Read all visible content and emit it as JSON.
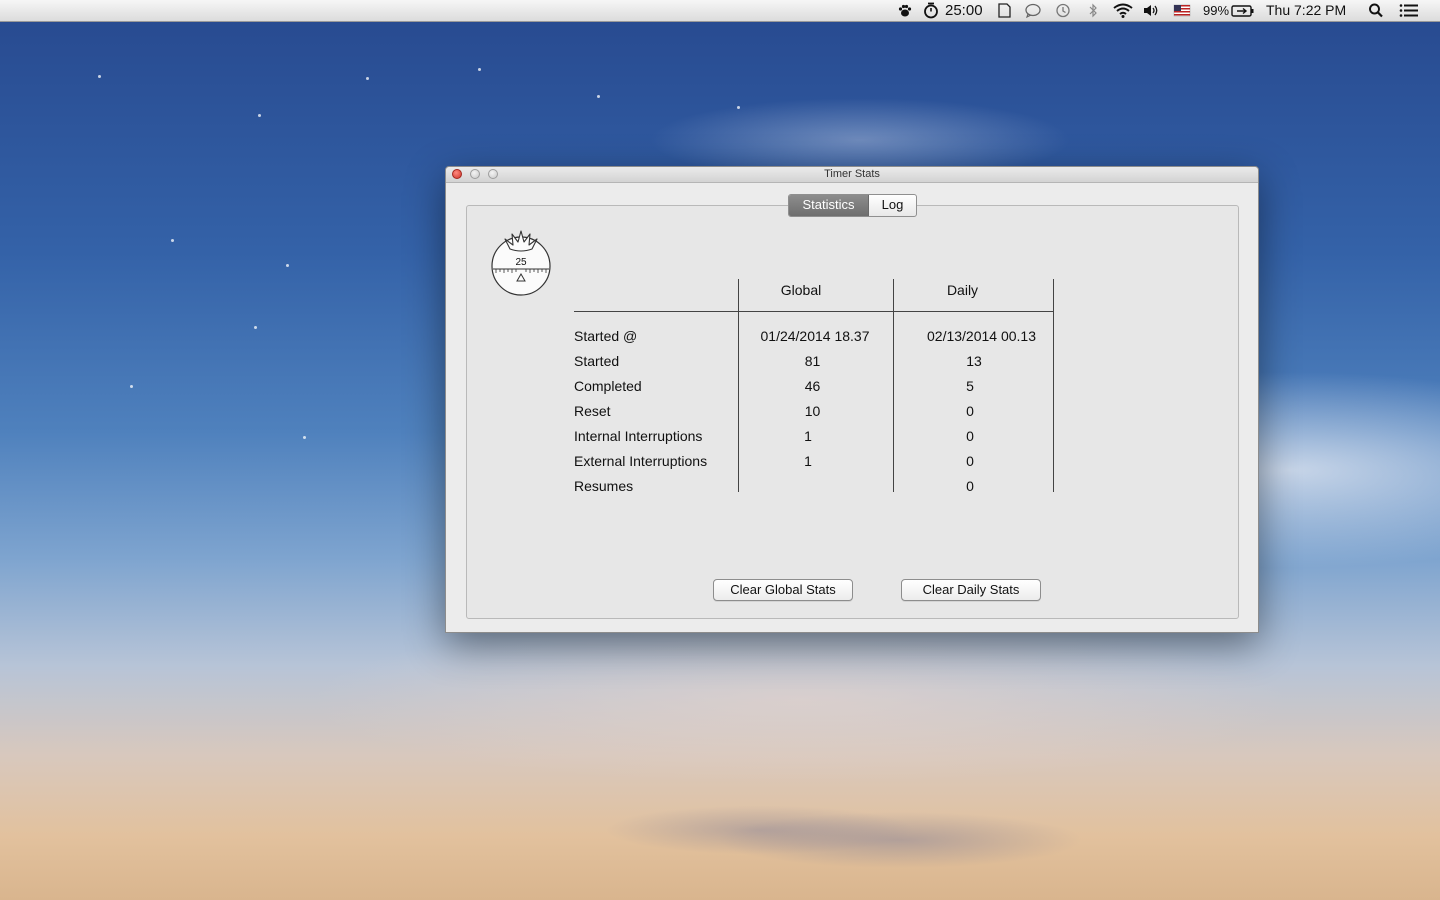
{
  "menubar": {
    "timer": "25:00",
    "battery": "99%",
    "clock": "Thu 7:22 PM"
  },
  "window": {
    "title": "Timer Stats",
    "tabs": [
      {
        "label": "Statistics",
        "selected": true
      },
      {
        "label": "Log",
        "selected": false
      }
    ],
    "logo_number": "25",
    "columns": [
      "Global",
      "Daily"
    ],
    "rows": [
      {
        "label": "Started @",
        "global": "01/24/2014 18.37",
        "daily": "02/13/2014 00.13"
      },
      {
        "label": "Started",
        "global": "81",
        "daily": "13"
      },
      {
        "label": "Completed",
        "global": "46",
        "daily": "5"
      },
      {
        "label": "Reset",
        "global": "10",
        "daily": "0"
      },
      {
        "label": "Internal Interruptions",
        "global": "1",
        "daily": "0"
      },
      {
        "label": "External Interruptions",
        "global": "1",
        "daily": "0"
      },
      {
        "label": "Resumes",
        "global": "",
        "daily": "0"
      }
    ],
    "buttons": {
      "clear_global": "Clear Global Stats",
      "clear_daily": "Clear Daily Stats"
    }
  }
}
